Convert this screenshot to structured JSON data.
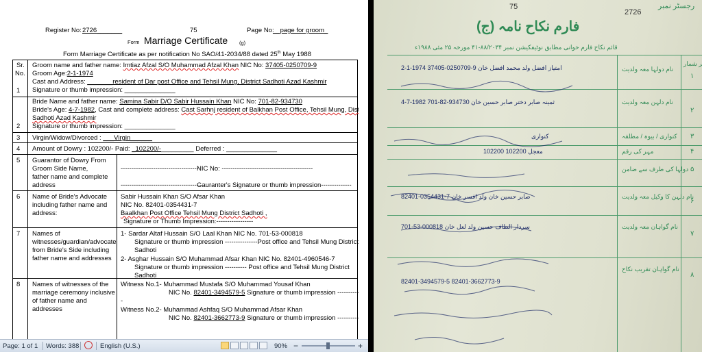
{
  "document": {
    "register_label": "Register No:",
    "register_no": "2726",
    "page_center": "75",
    "page_label": "Page No:",
    "page_value": "page for groom",
    "title_prefix": "Form",
    "title": "Marriage Certificate",
    "title_suffix": "(g)",
    "subtitle_a": "Form Marriage Certificate as per notification No SAO/41-2034/88 dated 25",
    "subtitle_sup": "th",
    "subtitle_b": " May 1988",
    "sr_head": "Sr.",
    "no_head": "No.",
    "rows": [
      {
        "num": "1",
        "l1_label": "Groom name and father name: ",
        "l1_value": "Imtiaz Afzal S/O Muhammad Afzal Khan",
        "l1_nic_label": " NIC No: ",
        "l1_nic": "37405-0250709-9",
        "l2_label": "Groom Age:",
        "l2_value": "2-1-1974",
        "l3_label": "Cast and Address: ",
        "l3_value": "_______resident of Dar post Office and Tehsil Mung, District Sadhoti Azad Kashmir",
        "l4": "Signature or thumb impression: ______________"
      },
      {
        "num": "2",
        "l1_label": "Bride Name and father name: ",
        "l1_value": "Samina Sabir D/O Sabir Hussain Khan",
        "l1_nic_label": " NIC No: ",
        "l1_nic": "701-82-934730",
        "l2_label": "Bride's Age: ",
        "l2_value": "4-7-1982",
        "l2_mid": ", Cast and complete address: ",
        "l2_tail": "Cast Sarhnj resident of Balkhan Post Office, Tehsil Mung, District",
        "l3": "Sadhoti Azad Kashmir",
        "l4": "Signature or thumb impression: ______________"
      },
      {
        "num": "3",
        "label": "Virgin/Widow/Divorced : ",
        "value": "___Virgin______"
      },
      {
        "num": "4",
        "a": "Amount of Dowry : 102200/- Paid: ",
        "b": "_102200/-",
        "c": "_________ Deferred : ______________"
      },
      {
        "num": "5",
        "left": [
          "Guarantor of Dowry From",
          "Groom Side Name,",
          "father name and complete",
          "address"
        ],
        "r1_dash": "------------------------------------",
        "r1_nic": "NIC No: ------------------------------------------",
        "r2_dash": "------------------------------------",
        "r2_sig": "Gauranter's Signature or thumb impression--------------"
      },
      {
        "num": "6",
        "left": [
          "Name of Bride's Advocate",
          "including father name and",
          "address:"
        ],
        "r1": "Sabir Hussain Khan S/O Afsar Khan",
        "r2": "NIC No. 82401-0354431-7",
        "r3": "Baalkhan Post Office Tehsil Mung District Sadhoti ,",
        "r4": "Signature or Thumb Impression:-----------------"
      },
      {
        "num": "7",
        "left": [
          "Names of",
          "witnesses/guardian/advocate",
          "from Bride's Side including",
          "father name and addresses"
        ],
        "w1": "1-   Sardar Altaf Hussain S/O Laal Khan NIC No. 701-53-000818",
        "w1b": "Signature or thumb impression ---------------Post office and Tehsil Mung District",
        "w1c": "Sadhoti",
        "w2": "2-   Asghar Hussain S/O Muhammad  Afsar Khan NIC No. 82401-4960546-7",
        "w2b": "Signature or thumb impression ---------- Post office and Tehsil Mung District",
        "w2c": "Sadhoti"
      },
      {
        "num": "8",
        "left": [
          "Names of witnesses of the",
          "marriage ceremony inclusive",
          "of father name and",
          "addresses"
        ],
        "w1": "Witness No.1- Muhammad  Mustafa S/O Muhammad Yousaf Khan",
        "w1_nic_label": "NIC No. ",
        "w1_nic": "82401-3494579-5",
        "w1_tail": " Signature or thumb impression ---------------",
        "dash": "-",
        "w2": "Witness No.2- Muhammad  Ashfaq S/O Muhammad  Afsar Khan",
        "w2_nic_label": "NIC No. ",
        "w2_nic": "82401-3662773-9",
        "w2_tail": " Signature or thumb impression ---------------"
      }
    ]
  },
  "statusbar": {
    "page": "Page: 1 of 1",
    "words": "Words: 388",
    "language": "English (U.S.)",
    "zoom": "90%",
    "minus": "−",
    "plus": "+"
  },
  "scan": {
    "corner_label": "رجسٹر نمبر",
    "page_number": "75",
    "register_number": "2726",
    "title": "فارم نکاح نامہ (ج)",
    "subtitle": "قائم نکاح فارم خوانی مطابق نوٹیفکیشن نمبر ۸۸/۲۰۳۴-۴۱ مورخہ ۲۵ مئی ۱۹۸۸ء",
    "column_header": "نمبر شمار",
    "rows": [
      {
        "num": "۱",
        "label": "نام دولہا معہ ولدیت",
        "ink": "2-1-1974  37405-0250709-9  امتیاز افضل ولد محمد افضل خان"
      },
      {
        "num": "۲",
        "label": "نام دلہن معہ ولدیت",
        "ink": "4-7-1982  701-82-934730  ثمینہ صابر دختر صابر حسین خان"
      },
      {
        "num": "۳",
        "label": "کنواری / بیوہ / مطلقہ",
        "ink": "کنواری"
      },
      {
        "num": "۴",
        "label": "مہر کی رقم",
        "ink": "102200  معجل  102200"
      },
      {
        "num": "۵",
        "label": "دولہا کی طرف سے ضامن",
        "ink": ""
      },
      {
        "num": "۶",
        "label": "نام دلہن کا وکیل معہ ولدیت",
        "ink": "82401-0354431-7  صابر حسین خان ولد افسر خان"
      },
      {
        "num": "۷",
        "label": "نام گواہان معہ ولدیت",
        "ink": "701-53-000818  سردار الطاف حسین ولد لعل خان"
      },
      {
        "num": "۸",
        "label": "نام گواہان تقریب نکاح",
        "ink": "82401-3494579-5   82401-3662773-9"
      }
    ]
  }
}
